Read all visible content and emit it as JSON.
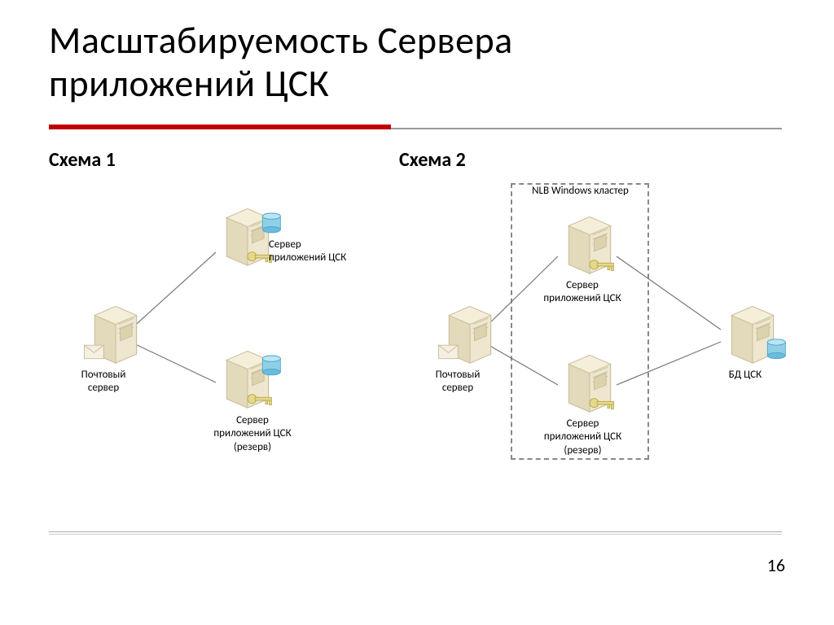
{
  "title_line1": "Масштабируемость Сервера",
  "title_line2": "приложений ЦСК",
  "scheme1": {
    "heading": "Схема 1",
    "nodes": {
      "mail": "Почтовый\nсервер",
      "app1": "Сервер\nприложений ЦСК",
      "app2": "Сервер\nприложений ЦСК\n(резерв)"
    }
  },
  "scheme2": {
    "heading": "Схема 2",
    "cluster_label": "NLB Windows кластер",
    "nodes": {
      "mail": "Почтовый\nсервер",
      "app1": "Сервер\nприложений ЦСК",
      "app2": "Сервер\nприложений ЦСК\n(резерв)",
      "db": "БД ЦСК"
    }
  },
  "page_number": "16"
}
